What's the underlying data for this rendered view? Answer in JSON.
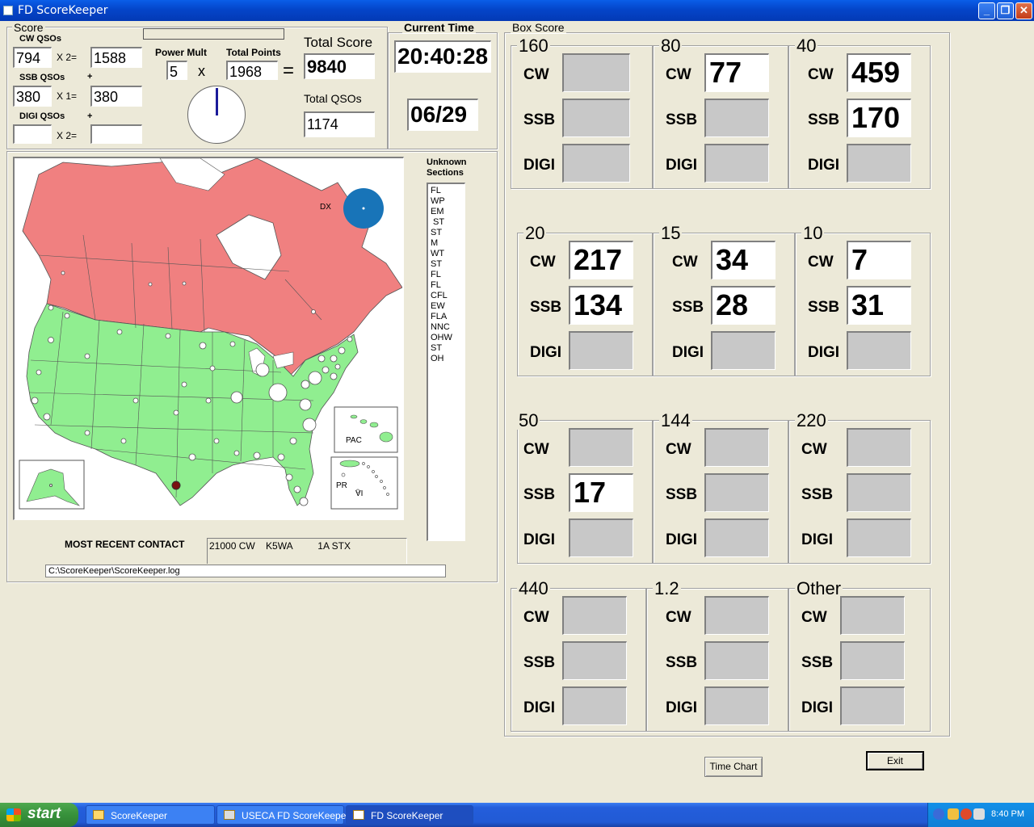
{
  "window": {
    "title": "FD ScoreKeeper",
    "buttons": [
      "_",
      "❐",
      "✕"
    ]
  },
  "score_frame": {
    "title": "Score",
    "cw_label": "CW QSOs",
    "cw_qsos": "794",
    "cw_mult": "X 2=",
    "cw_points": "1588",
    "plus1": "+",
    "ssb_label": "SSB QSOs",
    "ssb_qsos": "380",
    "ssb_mult": "X 1=",
    "ssb_points": "380",
    "plus2": "+",
    "digi_label": "DIGI QSOs",
    "digi_qsos": "",
    "digi_mult": "X 2=",
    "digi_points": "",
    "power_mult_label": "Power Mult",
    "power_mult": "5",
    "times": "x",
    "total_points_label": "Total Points",
    "total_points": "1968",
    "equals": "=",
    "total_score_label": "Total Score",
    "total_score": "9840",
    "total_qsos_label": "Total QSOs",
    "total_qsos": "1174"
  },
  "time_frame": {
    "title": "Current Time",
    "time": "20:40:28",
    "date": "06/29"
  },
  "map": {
    "dx_label": "DX",
    "pac_label": "PAC",
    "pr_label": "PR",
    "vi_label": "VI",
    "unknown_title_1": "Unknown",
    "unknown_title_2": "Sections",
    "unknown_sections": [
      "FL",
      "WP",
      "EM",
      " ST",
      "ST",
      "M",
      "WT",
      "ST",
      "FL",
      "FL",
      "CFL",
      "EW",
      "FLA",
      "NNC",
      "OHW",
      "ST",
      "OH"
    ],
    "recent_label": "MOST RECENT CONTACT",
    "recent": {
      "freq_mode": "21000 CW",
      "call": "K5WA",
      "exchange": "1A STX"
    },
    "log_path": "C:\\ScoreKeeper\\ScoreKeeper.log"
  },
  "box_score": {
    "title": "Box Score",
    "bands": [
      {
        "name": "160",
        "cw": "",
        "ssb": "",
        "digi": ""
      },
      {
        "name": "80",
        "cw": "77",
        "ssb": "",
        "digi": ""
      },
      {
        "name": "40",
        "cw": "459",
        "ssb": "170",
        "digi": ""
      },
      {
        "name": "20",
        "cw": "217",
        "ssb": "134",
        "digi": ""
      },
      {
        "name": "15",
        "cw": "34",
        "ssb": "28",
        "digi": ""
      },
      {
        "name": "10",
        "cw": "7",
        "ssb": "31",
        "digi": ""
      },
      {
        "name": "50",
        "cw": "",
        "ssb": "17",
        "digi": ""
      },
      {
        "name": "144",
        "cw": "",
        "ssb": "",
        "digi": ""
      },
      {
        "name": "220",
        "cw": "",
        "ssb": "",
        "digi": ""
      },
      {
        "name": "440",
        "cw": "",
        "ssb": "",
        "digi": ""
      },
      {
        "name": "1.2",
        "cw": "",
        "ssb": "",
        "digi": ""
      },
      {
        "name": "Other",
        "cw": "",
        "ssb": "",
        "digi": ""
      }
    ],
    "mode_labels": {
      "cw": "CW",
      "ssb": "SSB",
      "digi": "DIGI"
    }
  },
  "buttons": {
    "time_chart": "Time Chart",
    "exit": "Exit"
  },
  "taskbar": {
    "start": "start",
    "tasks": [
      "ScoreKeeper",
      "USECA FD ScoreKeeper",
      "FD ScoreKeeper"
    ],
    "clock": "8:40 PM"
  },
  "colors": {
    "canada": "#f08080",
    "usa": "#90ee90",
    "dx": "#1874b8",
    "title_bar": "#0445c9"
  }
}
